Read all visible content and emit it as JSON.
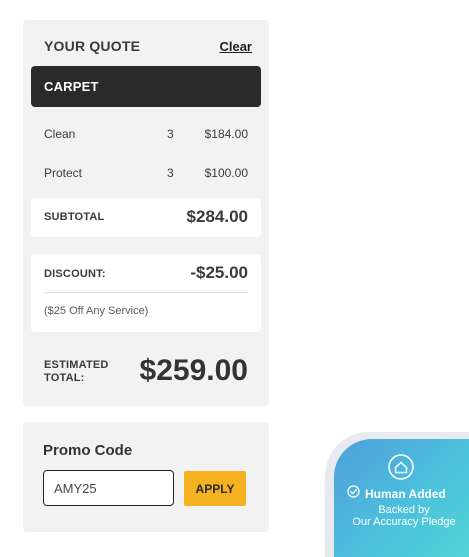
{
  "quote": {
    "title": "YOUR QUOTE",
    "clear_label": "Clear",
    "service": "CARPET",
    "line_items": [
      {
        "name": "Clean",
        "qty": "3",
        "price": "$184.00"
      },
      {
        "name": "Protect",
        "qty": "3",
        "price": "$100.00"
      }
    ],
    "subtotal_label": "SUBTOTAL",
    "subtotal_value": "$284.00",
    "discount_label": "DISCOUNT:",
    "discount_value": "-$25.00",
    "discount_note": "($25 Off Any Service)",
    "total_label_line1": "ESTIMATED",
    "total_label_line2": "TOTAL:",
    "total_value": "$259.00"
  },
  "promo": {
    "title": "Promo Code",
    "input_value": "AMY25",
    "apply_label": "APPLY"
  },
  "badge": {
    "title": "Human Added",
    "subtitle_line1": "Backed by",
    "subtitle_line2": "Our Accuracy Pledge",
    "icons": [
      "home-icon",
      "check-circle-icon"
    ]
  },
  "colors": {
    "card_bg": "#f2f2f2",
    "service_bar_bg": "#2a2a2a",
    "apply_button_bg": "#f5b120",
    "badge_gradient_start": "#4f9fdb",
    "badge_gradient_end": "#53d6d4"
  }
}
